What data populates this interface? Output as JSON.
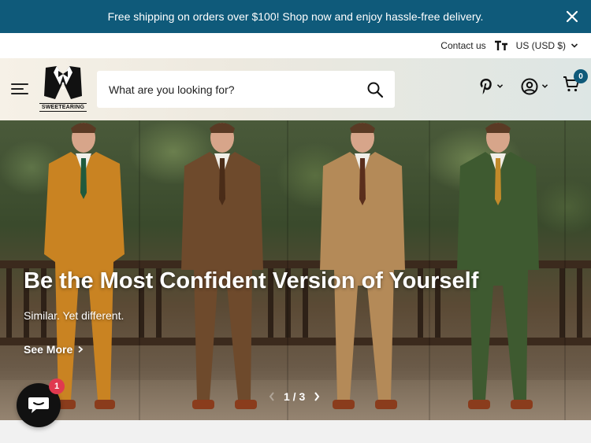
{
  "announcement": {
    "text": "Free shipping on orders over $100! Shop now and enjoy hassle-free delivery."
  },
  "utility": {
    "contact_label": "Contact us",
    "text_size_icon": "text-size-icon",
    "currency_label": "US (USD $)"
  },
  "header": {
    "logo_text": "SWEETEARING",
    "search_placeholder": "What are you looking for?",
    "cart_count": "0"
  },
  "hero": {
    "title": "Be the Most Confident Version of Yourself",
    "subtitle": "Similar. Yet different.",
    "link_label": "See More",
    "pager_label": "1 / 3"
  },
  "chat": {
    "badge_count": "1"
  },
  "colors": {
    "brand": "#0f5a7a",
    "badge": "#e0394f"
  }
}
